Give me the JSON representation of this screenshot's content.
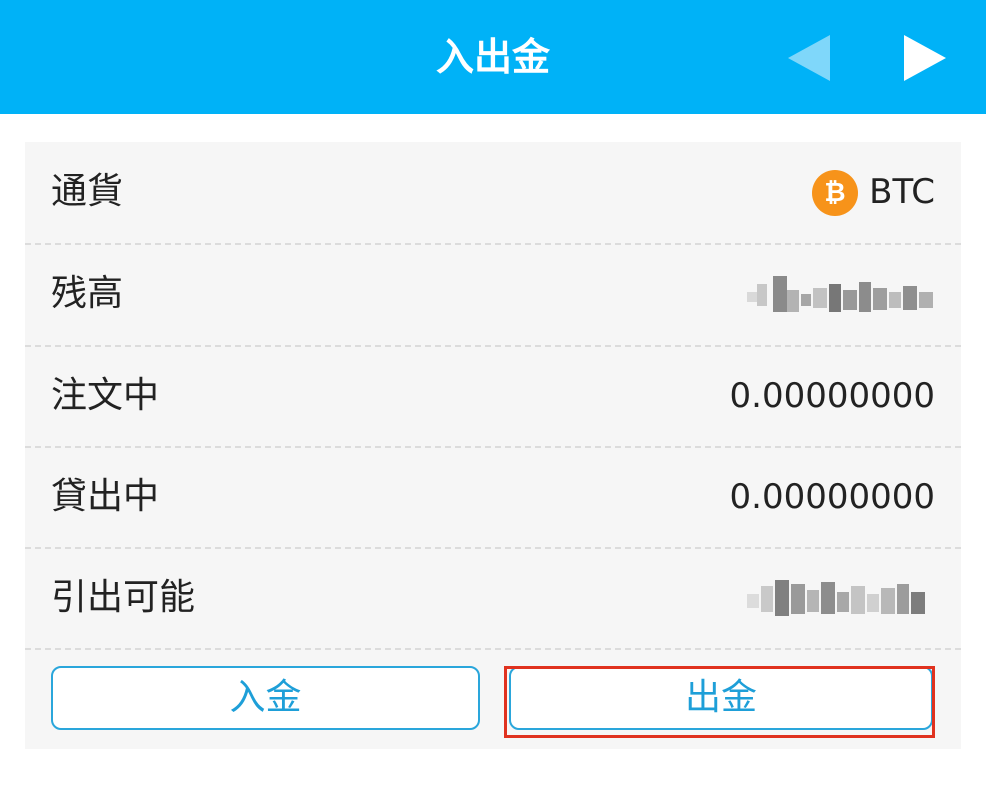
{
  "header": {
    "title": "入出金",
    "color": "#00b2f7",
    "prev_icon": "triangle-left-icon",
    "next_icon": "triangle-right-icon"
  },
  "rows": [
    {
      "label": "通貨",
      "value": "BTC",
      "icon": "bitcoin-icon",
      "icon_glyph": "₿"
    },
    {
      "label": "残高",
      "value": "",
      "redacted": true
    },
    {
      "label": "注文中",
      "value": "0.00000000"
    },
    {
      "label": "貸出中",
      "value": "0.00000000"
    },
    {
      "label": "引出可能",
      "value": "",
      "redacted": true
    }
  ],
  "buttons": {
    "deposit_label": "入金",
    "withdraw_label": "出金"
  },
  "colors": {
    "accent": "#00b2f7",
    "button_text": "#1e9fd8",
    "bitcoin": "#f7931a",
    "highlight": "#e0321f"
  }
}
